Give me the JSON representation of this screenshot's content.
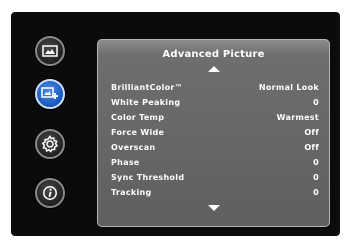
{
  "sidebar": {
    "items": [
      {
        "icon": "picture-icon"
      },
      {
        "icon": "advanced-picture-icon",
        "active": true
      },
      {
        "icon": "gear-icon"
      },
      {
        "icon": "info-icon"
      }
    ]
  },
  "menu": {
    "title": "Advanced Picture",
    "rows": [
      {
        "label": "BrilliantColor™",
        "value": "Normal Look"
      },
      {
        "label": "White Peaking",
        "value": "0"
      },
      {
        "label": "Color Temp",
        "value": "Warmest"
      },
      {
        "label": "Force Wide",
        "value": "Off"
      },
      {
        "label": "Overscan",
        "value": "Off"
      },
      {
        "label": "Phase",
        "value": "0"
      },
      {
        "label": "Sync Threshold",
        "value": "0"
      },
      {
        "label": "Tracking",
        "value": "0"
      }
    ]
  },
  "colors": {
    "panel": "#6e6e6e",
    "active_button": "#1f5fc4",
    "background": "#0b0b0b"
  }
}
